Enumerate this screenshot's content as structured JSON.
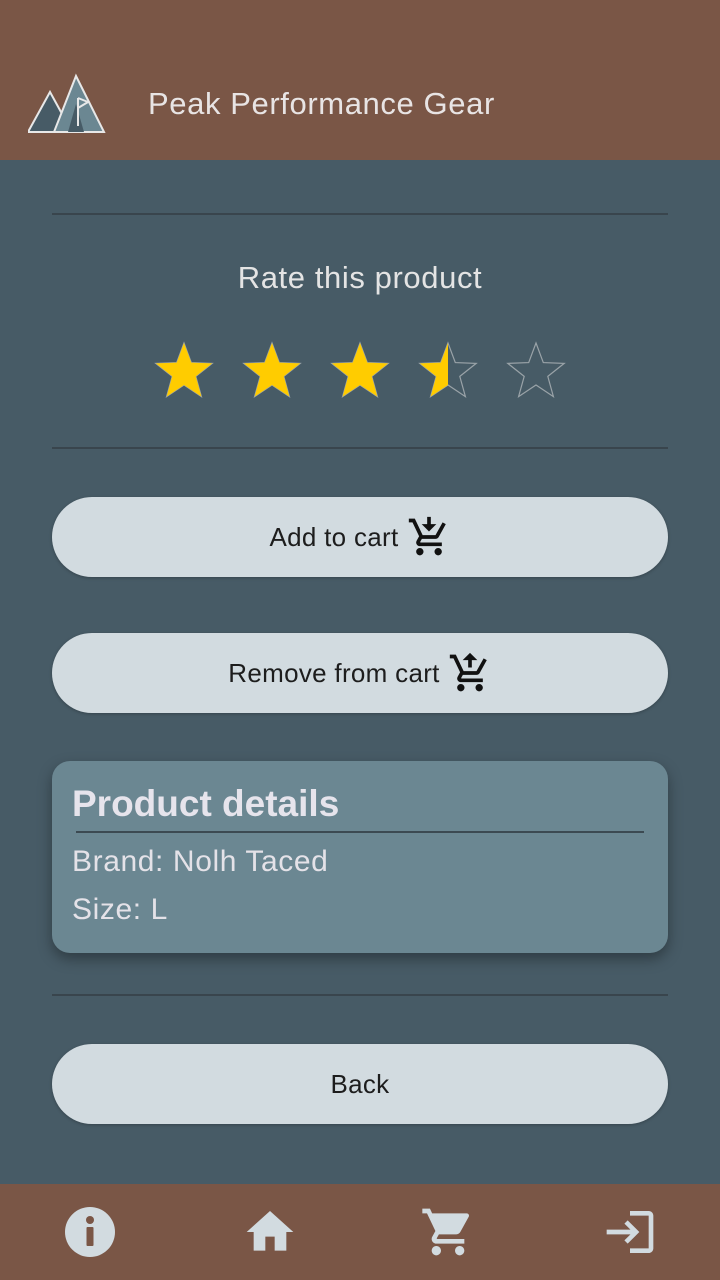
{
  "header": {
    "title": "Peak Performance Gear",
    "logo_icon": "mountain-logo-icon"
  },
  "rating": {
    "title": "Rate this product",
    "value": 3.5,
    "max": 5,
    "star_color": "#ffcc00"
  },
  "actions": {
    "add_label": "Add to cart",
    "add_icon": "cart-add-icon",
    "remove_label": "Remove from cart",
    "remove_icon": "cart-remove-icon",
    "back_label": "Back"
  },
  "details": {
    "title": "Product details",
    "brand": "Brand: Nolh Taced",
    "size": "Size: L"
  },
  "bottom_nav": {
    "items": [
      "info-icon",
      "home-icon",
      "cart-icon",
      "logout-icon"
    ]
  },
  "colors": {
    "header_bg": "#7a5646",
    "page_bg": "#475b66",
    "button_bg": "#d2dbe0",
    "card_bg": "#6b8792"
  }
}
